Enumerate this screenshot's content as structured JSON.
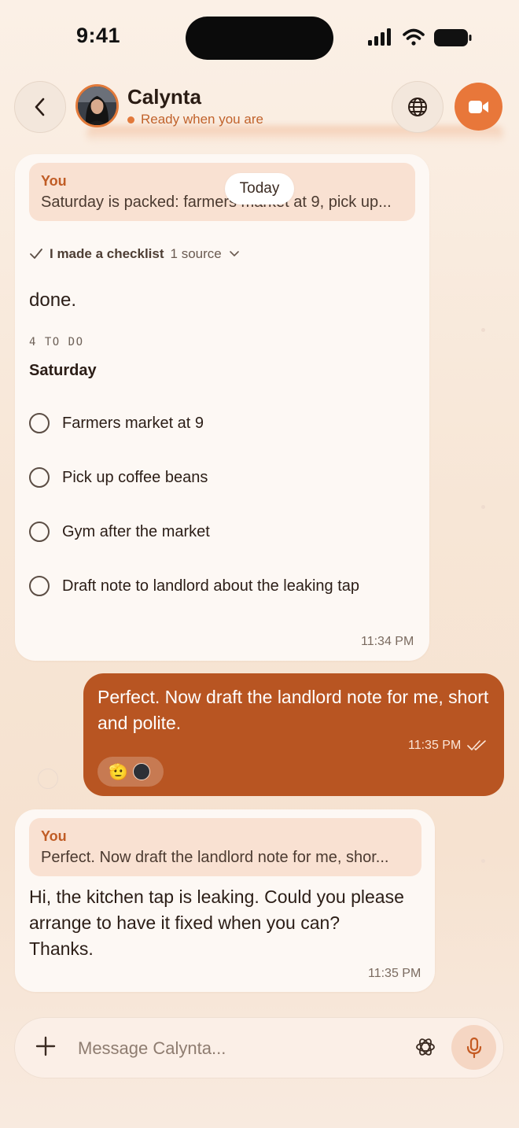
{
  "status_bar": {
    "time": "9:41"
  },
  "header": {
    "contact_name": "Calynta",
    "presence": "Ready when you are",
    "accent_color": "#e8773a"
  },
  "date_divider": "Today",
  "messages": {
    "checklist_message": {
      "quote_label": "You",
      "quote_text": "Saturday is packed: farmers market at 9, pick up...",
      "action_label": "I made a checklist",
      "sources_label": "1 source",
      "intro": "done.",
      "count_label": "4 TO DO",
      "group_title": "Saturday",
      "items": [
        {
          "text": "Farmers market at 9",
          "checked": false
        },
        {
          "text": "Pick up coffee beans",
          "checked": false
        },
        {
          "text": "Gym after the market",
          "checked": false
        },
        {
          "text": "Draft note to landlord about the leaking tap",
          "checked": false
        }
      ],
      "time": "11:34 PM"
    },
    "outgoing_message": {
      "text": "Perfect. Now draft the landlord note for me, short and polite.",
      "time": "11:35 PM",
      "reaction_emoji": "🫡"
    },
    "reply_message": {
      "quote_label": "You",
      "quote_text": "Perfect. Now draft the landlord note for me, shor...",
      "text": "Hi, the kitchen tap is leaking. Could you please arrange to have it fixed when you can? Thanks.",
      "time": "11:35 PM"
    }
  },
  "composer": {
    "placeholder": "Message Calynta..."
  },
  "colors": {
    "outgoing_bubble": "#b85522",
    "quote_bg": "#f9e1d2",
    "quote_label": "#c05c25"
  }
}
